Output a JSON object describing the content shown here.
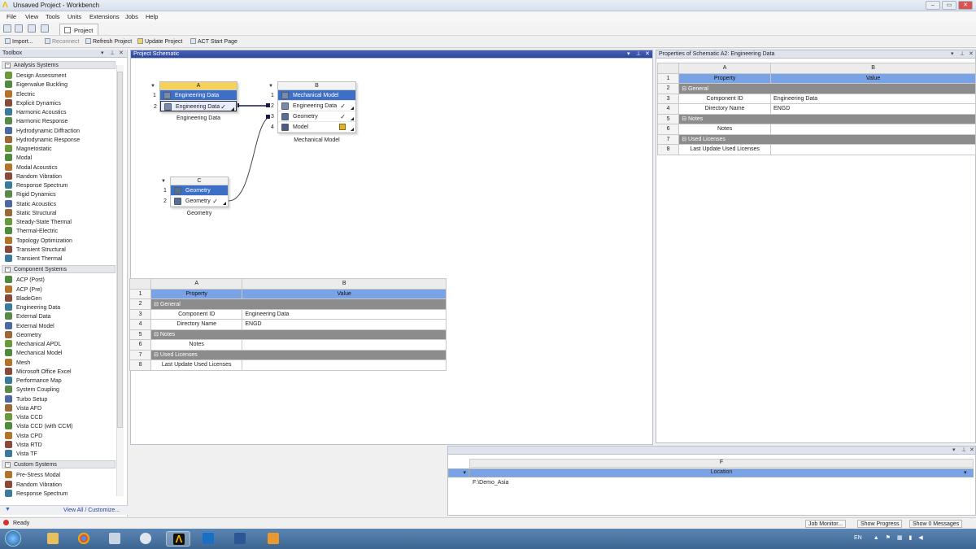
{
  "window": {
    "title": "Unsaved Project - Workbench"
  },
  "menu": [
    "File",
    "View",
    "Tools",
    "Units",
    "Extensions",
    "Jobs",
    "Help"
  ],
  "tab": {
    "label": "Project"
  },
  "toolbar": {
    "import": "Import...",
    "reconnect": "Reconnect",
    "refresh": "Refresh Project",
    "update": "Update Project",
    "act": "ACT Start Page"
  },
  "toolbox": {
    "title": "Toolbox",
    "sections": [
      {
        "label": "Analysis Systems",
        "items": [
          "Design Assessment",
          "Eigenvalue Buckling",
          "Electric",
          "Explicit Dynamics",
          "Harmonic Acoustics",
          "Harmonic Response",
          "Hydrodynamic Diffraction",
          "Hydrodynamic Response",
          "Magnetostatic",
          "Modal",
          "Modal Acoustics",
          "Random Vibration",
          "Response Spectrum",
          "Rigid Dynamics",
          "Static Acoustics",
          "Static Structural",
          "Steady-State Thermal",
          "Thermal-Electric",
          "Topology Optimization",
          "Transient Structural",
          "Transient Thermal"
        ]
      },
      {
        "label": "Component Systems",
        "items": [
          "ACP (Post)",
          "ACP (Pre)",
          "BladeGen",
          "Engineering Data",
          "External Data",
          "External Model",
          "Geometry",
          "Mechanical APDL",
          "Mechanical Model",
          "Mesh",
          "Microsoft Office Excel",
          "Performance Map",
          "System Coupling",
          "Turbo Setup",
          "Vista AFD",
          "Vista CCD",
          "Vista CCD (with CCM)",
          "Vista CPD",
          "Vista RTD",
          "Vista TF"
        ]
      },
      {
        "label": "Custom Systems",
        "items": [
          "Pre-Stress Modal",
          "Random Vibration",
          "Response Spectrum"
        ]
      }
    ],
    "footer": "View All / Customize..."
  },
  "schematic": {
    "title": "Project Schematic",
    "systems": [
      {
        "letter": "A",
        "label": "Engineering Data",
        "cells": [
          {
            "n": "1",
            "name": "Engineering Data"
          },
          {
            "n": "2",
            "name": "Engineering Data",
            "check": "✓"
          }
        ]
      },
      {
        "letter": "B",
        "label": "Mechanical Model",
        "cells": [
          {
            "n": "1",
            "name": "Mechanical Model"
          },
          {
            "n": "2",
            "name": "Engineering Data",
            "check": "✓"
          },
          {
            "n": "3",
            "name": "Geometry",
            "check": "✓"
          },
          {
            "n": "4",
            "name": "Model",
            "check": ""
          }
        ]
      },
      {
        "letter": "C",
        "label": "Geometry",
        "cells": [
          {
            "n": "1",
            "name": "Geometry"
          },
          {
            "n": "2",
            "name": "Geometry",
            "check": "✓"
          }
        ]
      }
    ]
  },
  "grid": {
    "colA": "A",
    "colB": "B",
    "rows": [
      {
        "n": "1",
        "type": "hdr",
        "a": "Property",
        "b": "Value"
      },
      {
        "n": "2",
        "type": "grp",
        "a": "General",
        "b": ""
      },
      {
        "n": "3",
        "type": "row",
        "a": "Component ID",
        "b": "Engineering Data"
      },
      {
        "n": "4",
        "type": "row",
        "a": "Directory Name",
        "b": "ENGD"
      },
      {
        "n": "5",
        "type": "grp",
        "a": "Notes",
        "b": ""
      },
      {
        "n": "6",
        "type": "row",
        "a": "Notes",
        "b": ""
      },
      {
        "n": "7",
        "type": "grp",
        "a": "Used Licenses",
        "b": ""
      },
      {
        "n": "8",
        "type": "row",
        "a": "Last Update Used Licenses",
        "b": ""
      }
    ]
  },
  "props": {
    "title": "Properties of Schematic A2: Engineering Data",
    "colA": "A",
    "colB": "B",
    "rows": [
      {
        "n": "1",
        "type": "hdr",
        "a": "Property",
        "b": "Value"
      },
      {
        "n": "2",
        "type": "grp",
        "a": "General",
        "b": ""
      },
      {
        "n": "3",
        "type": "row",
        "a": "Component ID",
        "b": "Engineering Data"
      },
      {
        "n": "4",
        "type": "row",
        "a": "Directory Name",
        "b": "ENGD"
      },
      {
        "n": "5",
        "type": "grp",
        "a": "Notes",
        "b": ""
      },
      {
        "n": "6",
        "type": "row",
        "a": "Notes",
        "b": ""
      },
      {
        "n": "7",
        "type": "grp",
        "a": "Used Licenses",
        "b": ""
      },
      {
        "n": "8",
        "type": "row",
        "a": "Last Update Used Licenses",
        "b": ""
      }
    ]
  },
  "files": {
    "col": "F",
    "header": "Location",
    "value": "F:\\Demo_Asia"
  },
  "status": {
    "text": "Ready",
    "job": "Job Monitor...",
    "progress": "Show Progress",
    "messages": "Show 0 Messages"
  },
  "tray": {
    "lang": "EN"
  }
}
